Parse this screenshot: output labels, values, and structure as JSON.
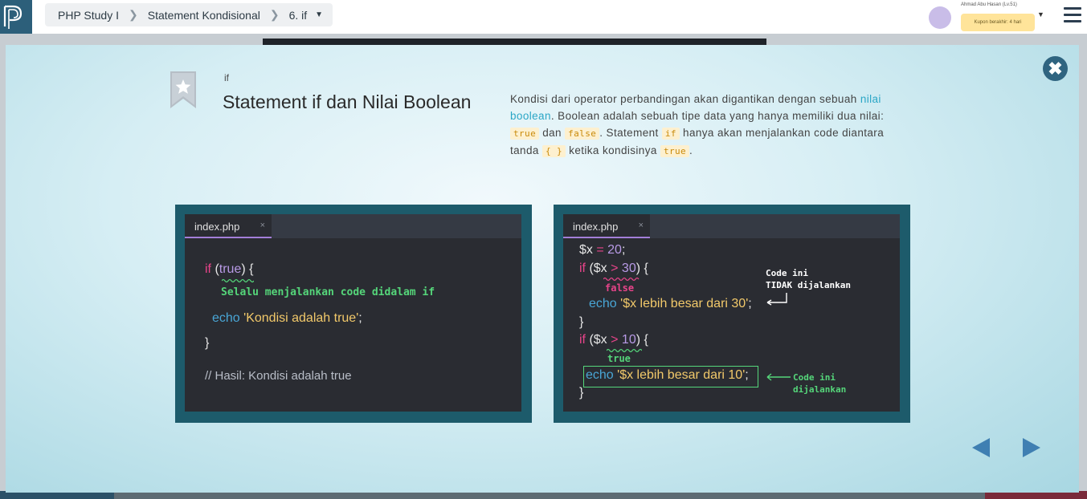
{
  "breadcrumb": {
    "course": "PHP Study I",
    "chapter": "Statement Kondisional",
    "lesson": "6. if"
  },
  "user": {
    "name": "Ahmad Abu Hasan (Lv.51)",
    "coupon": "Kupon berakhir: 4 hari"
  },
  "slide": {
    "tag": "if",
    "title": "Statement if dan Nilai Boolean",
    "desc_1": "Kondisi dari operator perbandingan akan digantikan dengan sebuah ",
    "desc_link": "nilai boolean",
    "desc_2": ". Boolean adalah sebuah tipe data yang hanya memiliki dua nilai: ",
    "code_true": "true",
    "desc_3": " dan ",
    "code_false": "false",
    "desc_4": ". Statement ",
    "code_if": "if",
    "desc_5": " hanya akan menjalankan code diantara tanda ",
    "code_braces": "{ }",
    "desc_6": " ketika kondisinya ",
    "desc_7": "."
  },
  "example1": {
    "tab": "index.php",
    "tab_close": "×",
    "kw_if": "if",
    "paren_open": " (",
    "cond": "true",
    "paren_close": ") {",
    "note": "Selalu menjalankan code didalam if",
    "echo": "echo",
    "str": "'Kondisi adalah true'",
    "semi": ";",
    "close_brace": "}",
    "comment": "// Hasil: Kondisi adalah true"
  },
  "example2": {
    "tab": "index.php",
    "tab_close": "×",
    "var_x": "$x",
    "assign": " = ",
    "num20": "20",
    "semi": ";",
    "kw_if": "if",
    "open_paren_var": " ($x ",
    "gt": ">",
    "num30": " 30",
    "close_paren": ") {",
    "note_false": "false",
    "echo": "echo",
    "str1": "'$x lebih besar dari 30'",
    "close_brace": "}",
    "num10": " 10",
    "note_true": "true",
    "str2": "'$x lebih besar dari 10'",
    "annot_not_run_1": "Code ini",
    "annot_not_run_2": "TIDAK dijalankan",
    "annot_run_1": "Code ini",
    "annot_run_2": "dijalankan"
  },
  "colors": {
    "accent": "#2aa6c6",
    "frame": "#1d5b6b",
    "editor": "#2a2c32",
    "nav": "#3f7fb2",
    "close": "#2f6480"
  },
  "icons": [
    "logo-icon",
    "chevron-right-icon",
    "caret-down-icon",
    "avatar-icon",
    "menu-icon",
    "close-icon",
    "bookmark-star-icon",
    "prev-arrow-icon",
    "next-arrow-icon"
  ]
}
